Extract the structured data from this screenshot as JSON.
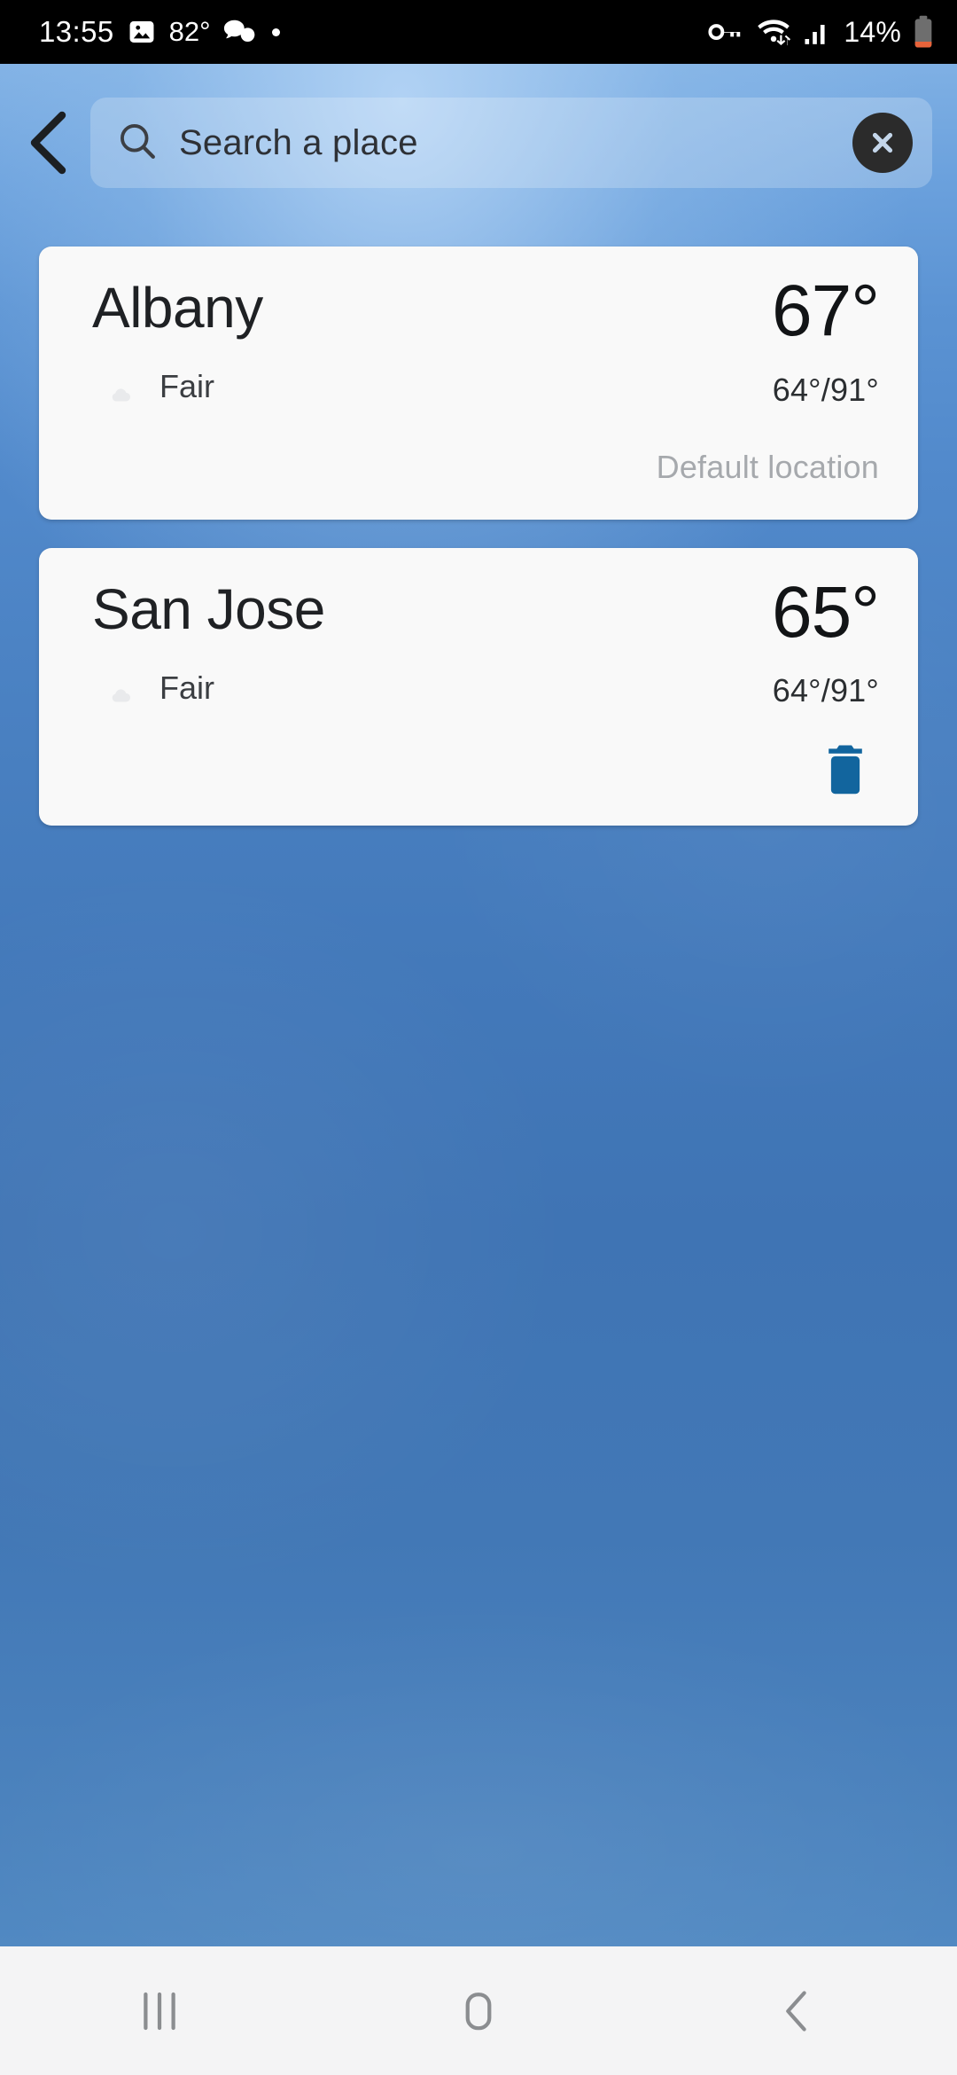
{
  "status_bar": {
    "time": "13:55",
    "temperature": "82°",
    "battery_percent": "14%",
    "icons": {
      "gallery": "image-icon",
      "messages": "chat-bubbles-icon",
      "notification_dot": "dot-icon",
      "vpn": "vpn-key-icon",
      "wifi": "wifi-icon",
      "signal": "cellular-signal-icon",
      "battery": "battery-low-icon"
    },
    "colors": {
      "background": "#000000",
      "foreground": "#ffffff",
      "battery_low": "#e8633a"
    }
  },
  "search": {
    "back_icon": "chevron-left-icon",
    "search_icon": "search-icon",
    "placeholder": "Search a place",
    "value": "",
    "clear_icon": "close-circle-icon"
  },
  "locations": [
    {
      "city": "Albany",
      "temperature": "67°",
      "condition": "Fair",
      "condition_icon": "moon-cloud-icon",
      "high_low": "64°/91°",
      "footer_label": "Default location",
      "footer_type": "default",
      "delete_icon": null
    },
    {
      "city": "San Jose",
      "temperature": "65°",
      "condition": "Fair",
      "condition_icon": "moon-cloud-icon",
      "high_low": "64°/91°",
      "footer_label": "",
      "footer_type": "delete",
      "delete_icon": "trash-icon"
    }
  ],
  "nav_bar": {
    "recents_icon": "recents-icon",
    "home_icon": "home-icon",
    "back_icon": "back-icon"
  },
  "colors": {
    "accent_blue": "#12659e",
    "card_background": "#f9f9f9",
    "muted_text": "#a6a9ad",
    "wallpaper_top": "#7fb0e4",
    "wallpaper_mid": "#3f74b4",
    "nav_background": "#f4f4f5"
  }
}
